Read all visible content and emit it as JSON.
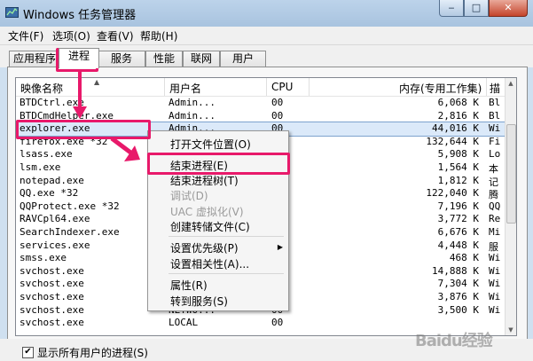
{
  "window": {
    "title": "Windows 任务管理器",
    "buttons": {
      "minimize": "‒",
      "maximize": "□",
      "close": "✕"
    }
  },
  "menu": [
    "文件(F)",
    "选项(O)",
    "查看(V)",
    "帮助(H)"
  ],
  "tabs": [
    "应用程序",
    "进程",
    "服务",
    "性能",
    "联网",
    "用户"
  ],
  "active_tab": "进程",
  "columns": [
    "映像名称",
    "用户名",
    "CPU",
    "内存(专用工作集)",
    "描"
  ],
  "rows": [
    {
      "name": "BTDCtrl.exe",
      "user": "Admin...",
      "cpu": "00",
      "mem": "6,068 K",
      "desc": "Bl"
    },
    {
      "name": "BTDCmdHelper.exe",
      "user": "Admin...",
      "cpu": "00",
      "mem": "2,816 K",
      "desc": "Bl"
    },
    {
      "name": "explorer.exe",
      "user": "Admin...",
      "cpu": "00",
      "mem": "44,016 K",
      "desc": "Wi"
    },
    {
      "name": "firefox.exe *32",
      "user": "",
      "cpu": "",
      "mem": "132,644 K",
      "desc": "Fi"
    },
    {
      "name": "lsass.exe",
      "user": "",
      "cpu": "",
      "mem": "5,908 K",
      "desc": "Lo"
    },
    {
      "name": "lsm.exe",
      "user": "",
      "cpu": "",
      "mem": "1,564 K",
      "desc": "本"
    },
    {
      "name": "notepad.exe",
      "user": "",
      "cpu": "",
      "mem": "1,812 K",
      "desc": "记"
    },
    {
      "name": "QQ.exe *32",
      "user": "",
      "cpu": "",
      "mem": "122,040 K",
      "desc": "腾"
    },
    {
      "name": "QQProtect.exe *32",
      "user": "",
      "cpu": "",
      "mem": "7,196 K",
      "desc": "QQ"
    },
    {
      "name": "RAVCpl64.exe",
      "user": "",
      "cpu": "",
      "mem": "3,772 K",
      "desc": "Re"
    },
    {
      "name": "SearchIndexer.exe",
      "user": "",
      "cpu": "",
      "mem": "6,676 K",
      "desc": "Mi"
    },
    {
      "name": "services.exe",
      "user": "",
      "cpu": "",
      "mem": "4,448 K",
      "desc": "服"
    },
    {
      "name": "smss.exe",
      "user": "",
      "cpu": "",
      "mem": "468 K",
      "desc": "Wi"
    },
    {
      "name": "svchost.exe",
      "user": "",
      "cpu": "",
      "mem": "14,888 K",
      "desc": "Wi"
    },
    {
      "name": "svchost.exe",
      "user": "",
      "cpu": "",
      "mem": "7,304 K",
      "desc": "Wi"
    },
    {
      "name": "svchost.exe",
      "user": "",
      "cpu": "",
      "mem": "3,876 K",
      "desc": "Wi"
    },
    {
      "name": "svchost.exe",
      "user": "NETWO...",
      "cpu": "00",
      "mem": "3,500 K",
      "desc": "Wi"
    },
    {
      "name": "svchost.exe",
      "user": "LOCAL",
      "cpu": "00",
      "mem": "",
      "desc": ""
    }
  ],
  "selected_row": "explorer.exe",
  "context_menu": {
    "items": [
      {
        "label": "打开文件位置(O)",
        "enabled": true
      },
      {
        "label": "结束进程(E)",
        "enabled": true
      },
      {
        "label": "结束进程树(T)",
        "enabled": true
      },
      {
        "label": "调试(D)",
        "enabled": false
      },
      {
        "label": "UAC 虚拟化(V)",
        "enabled": false
      },
      {
        "label": "创建转储文件(C)",
        "enabled": true
      },
      {
        "label": "设置优先级(P)",
        "enabled": true,
        "submenu": true
      },
      {
        "label": "设置相关性(A)...",
        "enabled": true
      },
      {
        "label": "属性(R)",
        "enabled": true
      },
      {
        "label": "转到服务(S)",
        "enabled": true
      }
    ]
  },
  "show_all_users": {
    "label": "显示所有用户的进程(S)",
    "checked": true,
    "mark": "✔"
  },
  "watermark": "Baidu经验",
  "colors": {
    "highlight": "#e8196a",
    "selection": "#dbe9f9"
  }
}
